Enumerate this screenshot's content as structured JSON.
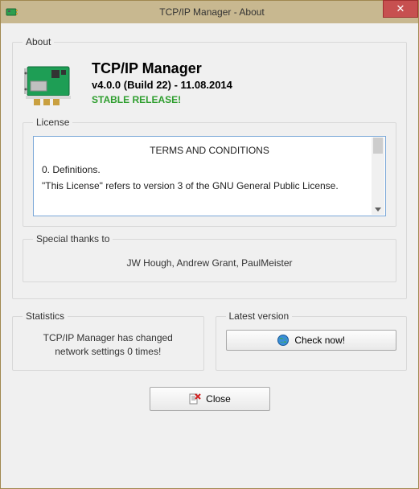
{
  "window": {
    "title": "TCP/IP Manager - About"
  },
  "about": {
    "legend": "About",
    "app_name": "TCP/IP Manager",
    "version_line": "v4.0.0 (Build 22) - 11.08.2014",
    "release_label": "STABLE RELEASE!",
    "license": {
      "legend": "License",
      "heading": "TERMS AND CONDITIONS",
      "section0": "0. Definitions.",
      "para1": "\"This License\" refers to version 3 of the GNU General Public License."
    },
    "thanks": {
      "legend": "Special thanks to",
      "text": "JW Hough, Andrew Grant, PaulMeister"
    }
  },
  "statistics": {
    "legend": "Statistics",
    "line1": "TCP/IP Manager has changed",
    "line2": "network settings 0 times!"
  },
  "latest": {
    "legend": "Latest version",
    "button": "Check now!"
  },
  "close_button": "Close"
}
